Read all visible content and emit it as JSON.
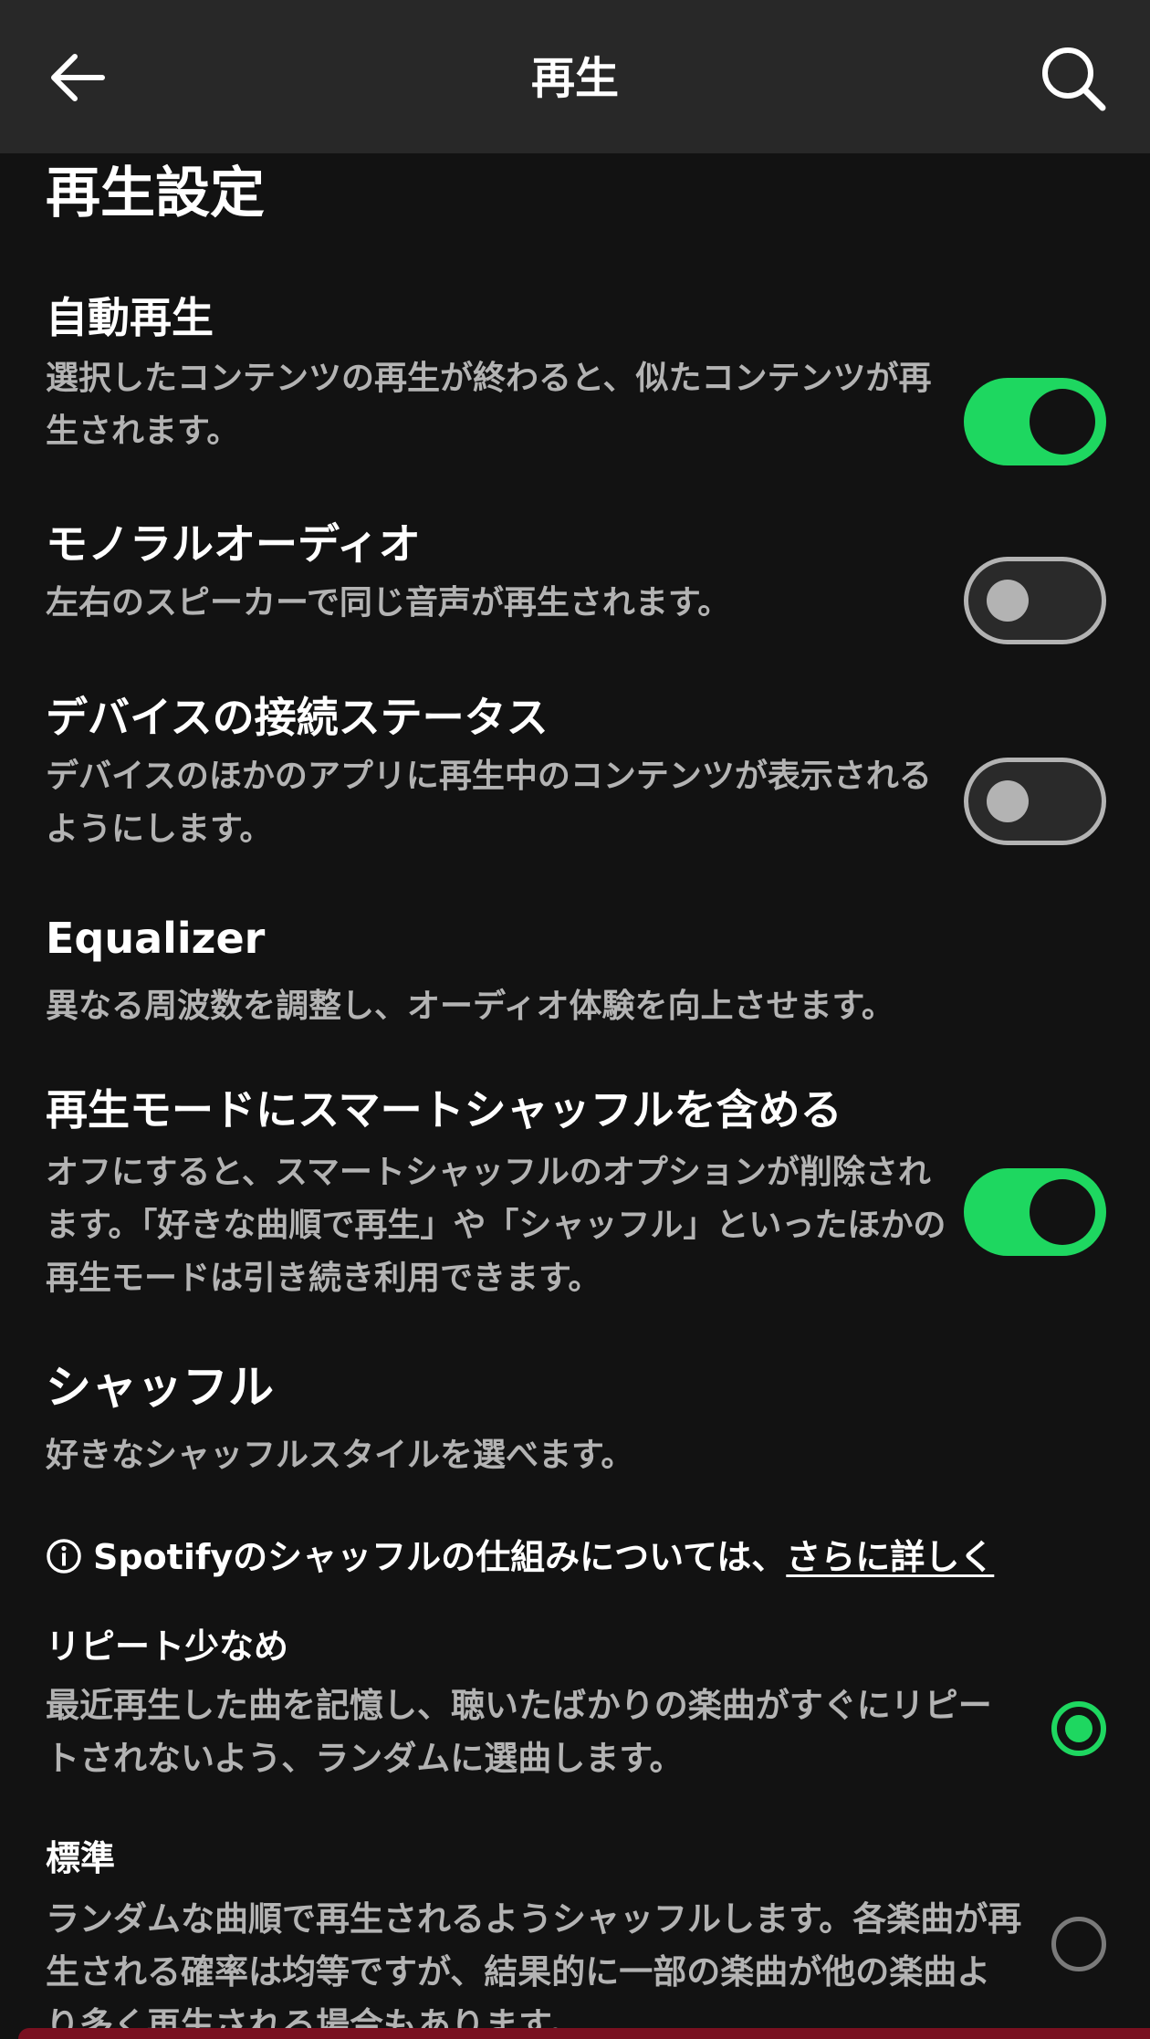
{
  "header": {
    "title": "再生",
    "back_icon": "arrow-left-icon",
    "search_icon": "search-icon"
  },
  "section_title": "再生設定",
  "settings": [
    {
      "label": "自動再生",
      "description": "選択したコンテンツの再生が終わると、似たコンテンツが再生されます。",
      "toggle": "on"
    },
    {
      "label": "モノラルオーディオ",
      "description": "左右のスピーカーで同じ音声が再生されます。",
      "toggle": "off"
    },
    {
      "label": "デバイスの接続ステータス",
      "description": "デバイスのほかのアプリに再生中のコンテンツが表示されるようにします。",
      "toggle": "off"
    },
    {
      "label": "Equalizer",
      "description": "異なる周波数を調整し、オーディオ体験を向上させます。"
    },
    {
      "label": "再生モードにスマートシャッフルを含める",
      "description": "オフにすると、スマートシャッフルのオプションが削除されます。「好きな曲順で再生」や「シャッフル」といったほかの再生モードは引き続き利用できます。",
      "toggle": "on"
    },
    {
      "label": "シャッフル",
      "description": "好きなシャッフルスタイルを選べます。"
    }
  ],
  "info": {
    "text": "Spotifyのシャッフルの仕組みについては、",
    "link": "さらに詳しく",
    "icon": "info-icon"
  },
  "shuffle_options": [
    {
      "label": "リピート少なめ",
      "description": "最近再生した曲を記憶し、聴いたばかりの楽曲がすぐにリピートされないよう、ランダムに選曲します。",
      "selected": true
    },
    {
      "label": "標準",
      "description": "ランダムな曲順で再生されるようシャッフルします。各楽曲が再生される確率は均等ですが、結果的に一部の楽曲が他の楽曲より多く再生される場合もあります。",
      "selected": false
    }
  ],
  "colors": {
    "accent": "#1ed760",
    "background": "#121212",
    "header": "#282828",
    "secondary_text": "#b3b3b3"
  }
}
